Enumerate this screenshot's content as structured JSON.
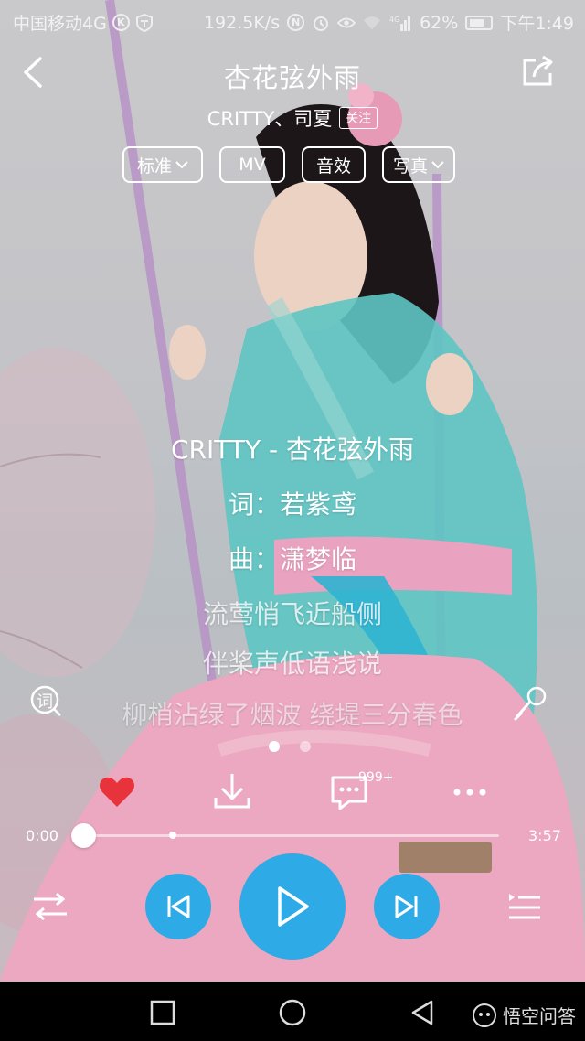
{
  "status_bar": {
    "carrier": "中国移动4G",
    "speed": "192.5K/s",
    "network": "4G",
    "battery": "62%",
    "time": "下午1:49"
  },
  "header": {
    "title": "杏花弦外雨",
    "artist": "CRITTY、司夏",
    "follow_label": "关注"
  },
  "options": {
    "quality": "标准",
    "mv": "MV",
    "effects": "音效",
    "photo": "写真"
  },
  "lyrics": [
    "CRITTY - 杏花弦外雨",
    "词：若紫鸢",
    "曲：潇梦临",
    "流莺悄飞近船侧",
    "伴桨声低语浅说",
    "柳梢沾绿了烟波 绕堤三分春色"
  ],
  "lyric_button": "词",
  "actions": {
    "comment_count": "999+"
  },
  "progress": {
    "elapsed": "0:00",
    "duration": "3:57",
    "fraction": 0.0
  },
  "watermark": "悟空问答",
  "colors": {
    "accent": "#2eaae6",
    "heart": "#e8323c"
  }
}
